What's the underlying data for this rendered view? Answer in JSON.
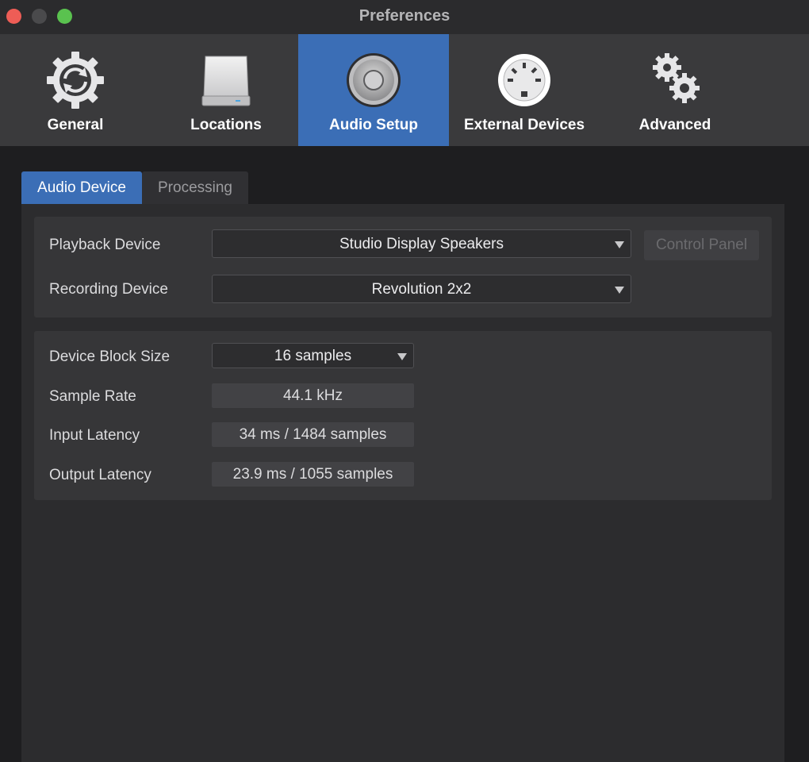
{
  "window": {
    "title": "Preferences"
  },
  "toolbar": {
    "items": [
      {
        "label": "General",
        "icon": "gear-refresh-icon"
      },
      {
        "label": "Locations",
        "icon": "drive-icon"
      },
      {
        "label": "Audio Setup",
        "icon": "speaker-icon"
      },
      {
        "label": "External Devices",
        "icon": "midi-port-icon"
      },
      {
        "label": "Advanced",
        "icon": "gears-icon"
      }
    ],
    "active": "Audio Setup"
  },
  "subtabs": {
    "items": [
      "Audio Device",
      "Processing"
    ],
    "active": "Audio Device"
  },
  "devices": {
    "playback_label": "Playback Device",
    "playback_value": "Studio Display Speakers",
    "recording_label": "Recording Device",
    "recording_value": "Revolution 2x2",
    "control_panel_label": "Control Panel"
  },
  "settings": {
    "block_size_label": "Device Block Size",
    "block_size_value": "16 samples",
    "sample_rate_label": "Sample Rate",
    "sample_rate_value": "44.1 kHz",
    "input_latency_label": "Input Latency",
    "input_latency_value": "34 ms / 1484 samples",
    "output_latency_label": "Output Latency",
    "output_latency_value": "23.9 ms / 1055 samples"
  },
  "colors": {
    "accent": "#3b6eb6",
    "close": "#ee5d56",
    "maximize": "#5ac24f"
  }
}
